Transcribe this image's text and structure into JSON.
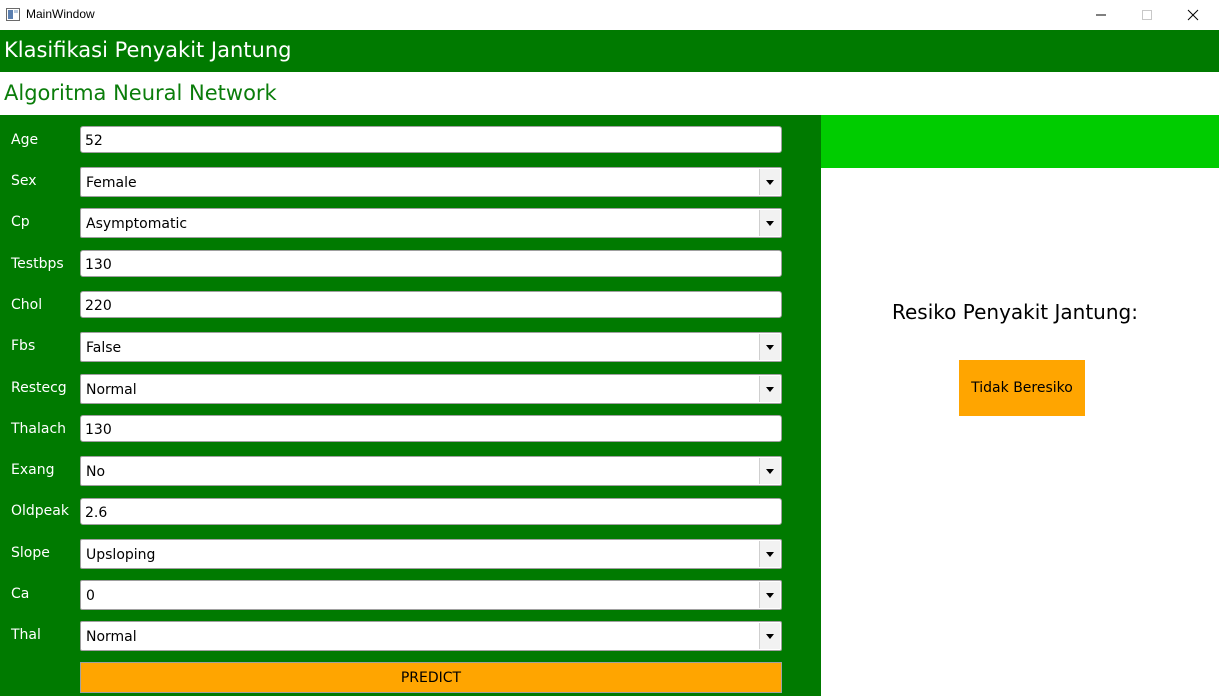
{
  "window": {
    "title": "MainWindow",
    "icons": {
      "minimize": "minimize-icon",
      "maximize": "maximize-icon",
      "close": "close-icon"
    }
  },
  "header": {
    "title": "Klasifikasi Penyakit Jantung"
  },
  "subheader": {
    "title": "Algoritma Neural Network"
  },
  "form": {
    "fields": [
      {
        "label": "Age",
        "type": "text",
        "value": "52"
      },
      {
        "label": "Sex",
        "type": "select",
        "value": "Female"
      },
      {
        "label": "Cp",
        "type": "select",
        "value": "Asymptomatic"
      },
      {
        "label": "Testbps",
        "type": "text",
        "value": "130"
      },
      {
        "label": "Chol",
        "type": "text",
        "value": "220"
      },
      {
        "label": "Fbs",
        "type": "select",
        "value": "False"
      },
      {
        "label": "Restecg",
        "type": "select",
        "value": "Normal"
      },
      {
        "label": "Thalach",
        "type": "text",
        "value": "130"
      },
      {
        "label": "Exang",
        "type": "select",
        "value": "No"
      },
      {
        "label": "Oldpeak",
        "type": "text",
        "value": "2.6"
      },
      {
        "label": "Slope",
        "type": "select",
        "value": "Upsloping"
      },
      {
        "label": "Ca",
        "type": "select",
        "value": "0"
      },
      {
        "label": "Thal",
        "type": "select",
        "value": "Normal"
      }
    ],
    "predict_label": "PREDICT"
  },
  "result": {
    "title": "Resiko Penyakit Jantung:",
    "value": "Tidak Beresiko"
  },
  "colors": {
    "header_bg": "#007a00",
    "panel_bg": "#007a00",
    "subheader_text": "#0a7d0a",
    "result_banner": "#00cc00",
    "accent_orange": "#ffa500"
  }
}
